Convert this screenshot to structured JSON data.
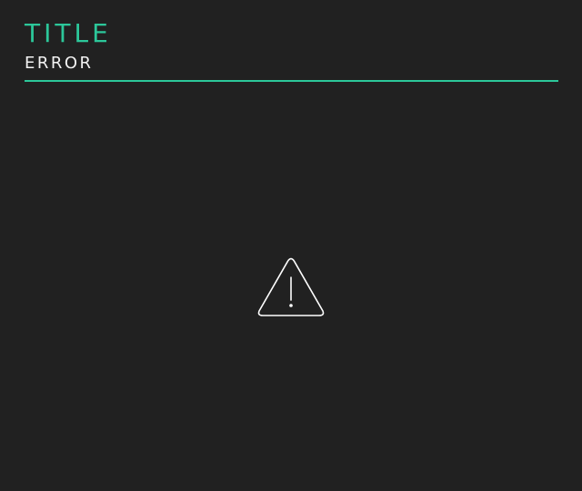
{
  "header": {
    "title": "TITLE",
    "subtitle": "ERROR"
  },
  "icon": {
    "name": "warning-icon"
  },
  "colors": {
    "background": "#212121",
    "accent": "#2cc79a",
    "text": "#f2f2f2",
    "icon": "#ffffff"
  }
}
